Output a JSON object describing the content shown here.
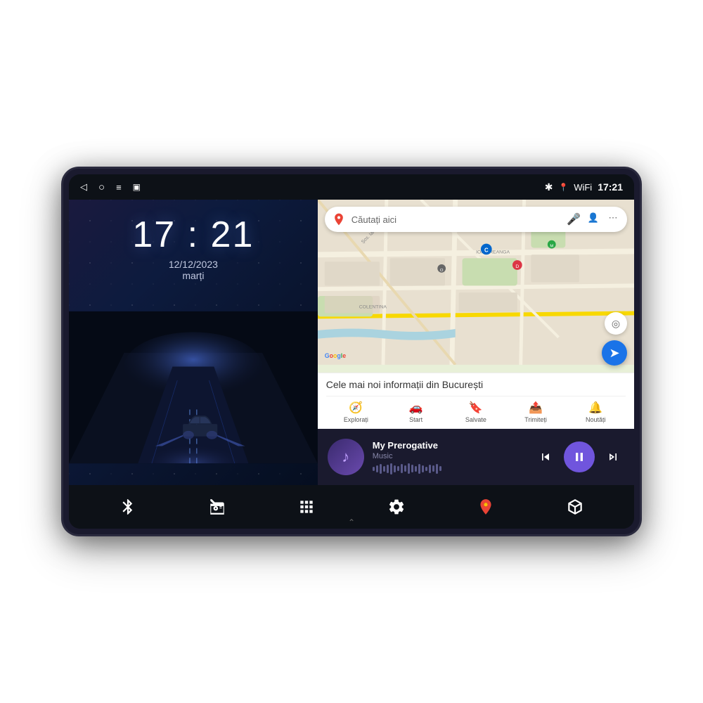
{
  "device": {
    "status_bar": {
      "time": "17:21",
      "icons_left": [
        "back-arrow",
        "circle",
        "menu",
        "square"
      ],
      "icons_right": [
        "bluetooth",
        "location",
        "wifi",
        "time"
      ]
    },
    "left_panel": {
      "clock": "17 : 21",
      "date": "12/12/2023",
      "day": "marți"
    },
    "right_panel": {
      "map": {
        "search_placeholder": "Căutați aici",
        "info_title": "Cele mai noi informații din București",
        "nav_items": [
          {
            "label": "Explorați",
            "icon": "compass"
          },
          {
            "label": "Start",
            "icon": "car"
          },
          {
            "label": "Salvate",
            "icon": "bookmark"
          },
          {
            "label": "Trimiteți",
            "icon": "share"
          },
          {
            "label": "Noutăți",
            "icon": "bell"
          }
        ]
      },
      "music": {
        "title": "My Prerogative",
        "subtitle": "Music",
        "album_icon": "♪"
      }
    },
    "bottom_nav": {
      "items": [
        {
          "label": "bluetooth",
          "icon": "bluetooth"
        },
        {
          "label": "radio",
          "icon": "radio"
        },
        {
          "label": "apps",
          "icon": "grid"
        },
        {
          "label": "settings",
          "icon": "settings"
        },
        {
          "label": "maps",
          "icon": "maps"
        },
        {
          "label": "box",
          "icon": "box"
        }
      ]
    }
  }
}
